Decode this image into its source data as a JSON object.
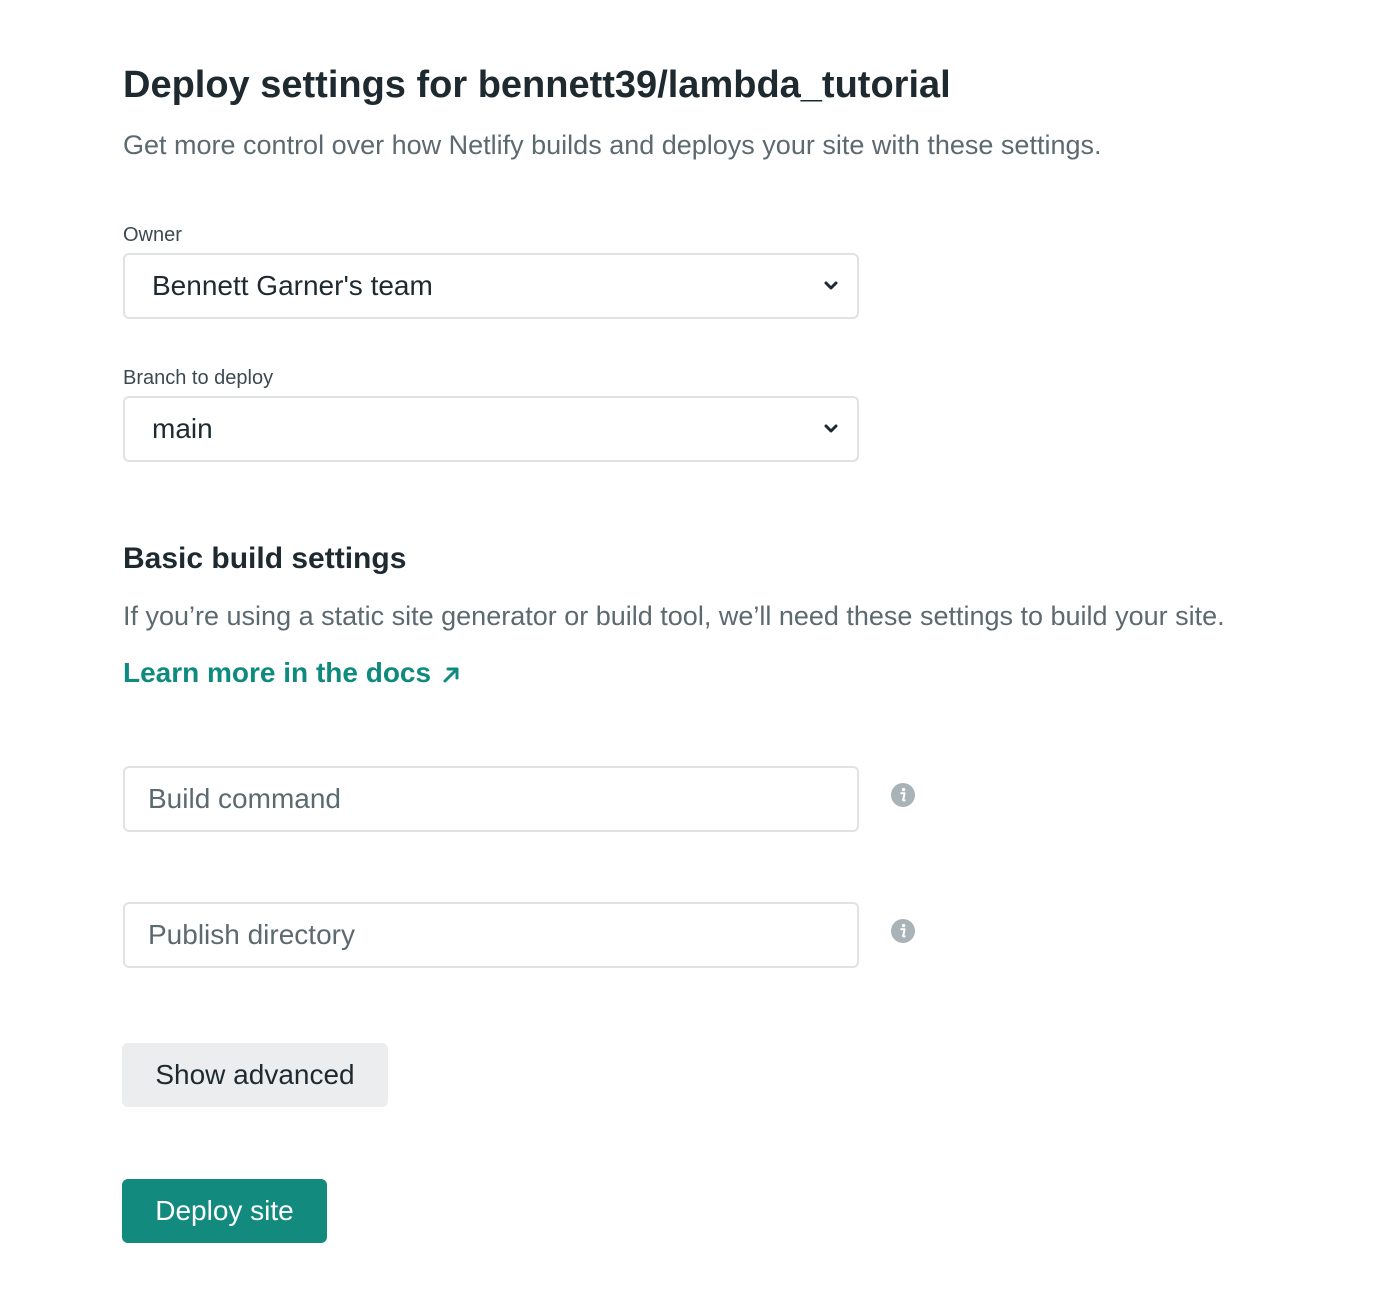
{
  "header": {
    "title": "Deploy settings for bennett39/lambda_tutorial",
    "subtitle": "Get more control over how Netlify builds and deploys your site with these settings."
  },
  "owner": {
    "label": "Owner",
    "selected": "Bennett Garner's team"
  },
  "branch": {
    "label": "Branch to deploy",
    "selected": "main"
  },
  "build_settings": {
    "title": "Basic build settings",
    "description": "If you’re using a static site generator or build tool, we’ll need these settings to build your site.",
    "docs_link": "Learn more in the docs",
    "build_command": {
      "value": "",
      "placeholder": "Build command"
    },
    "publish_directory": {
      "value": "",
      "placeholder": "Publish directory"
    }
  },
  "buttons": {
    "show_advanced": "Show advanced",
    "deploy": "Deploy site"
  },
  "icons": {
    "select_chevron": "chevron-down-icon",
    "docs_arrow": "arrow-up-right-icon",
    "field_help": "info-icon"
  },
  "colors": {
    "accent": "#138a7e",
    "link": "#0e8a7e",
    "secondary_button": "#ebedee",
    "info_icon": "#a9b3b7"
  }
}
